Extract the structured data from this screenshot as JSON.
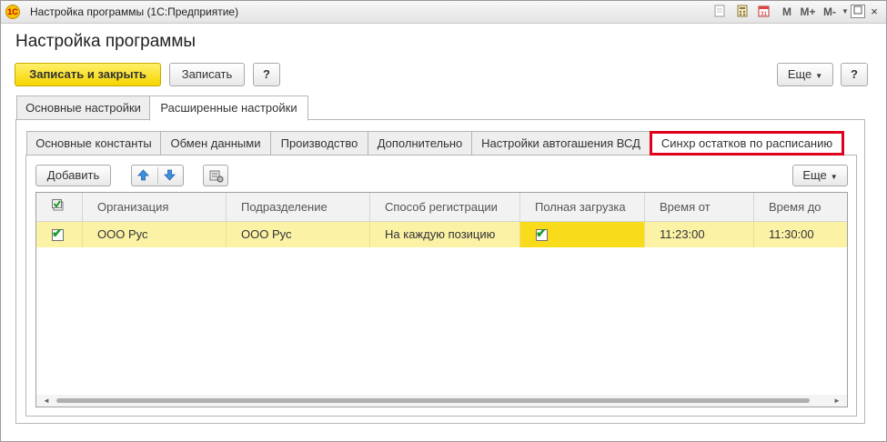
{
  "window": {
    "title": "Настройка программы  (1С:Предприятие)",
    "app_icon": "1c-logo-icon",
    "tool_m": "M",
    "tool_mplus": "M+",
    "tool_mminus": "M-",
    "close": "×"
  },
  "page": {
    "title": "Настройка программы"
  },
  "toolbar": {
    "save_close": "Записать и закрыть",
    "save": "Записать",
    "help": "?",
    "more": "Еще",
    "help2": "?"
  },
  "tabs": [
    {
      "label": "Основные настройки"
    },
    {
      "label": "Расширенные настройки"
    }
  ],
  "subtabs": [
    {
      "label": "Основные константы"
    },
    {
      "label": "Обмен данными"
    },
    {
      "label": "Производство"
    },
    {
      "label": "Дополнительно"
    },
    {
      "label": "Настройки автогашения ВСД"
    },
    {
      "label": "Синхр остатков по расписанию"
    }
  ],
  "table_toolbar": {
    "add": "Добавить",
    "more": "Еще"
  },
  "table": {
    "columns": [
      "Организация",
      "Подразделение",
      "Способ регистрации",
      "Полная загрузка",
      "Время от",
      "Время до"
    ],
    "rows": [
      {
        "active": true,
        "org": "ООО Рус",
        "dept": "ООО Рус",
        "method": "На каждую позицию",
        "full_load": true,
        "time_from": "11:23:00",
        "time_to": "11:30:00"
      }
    ]
  },
  "colors": {
    "highlight_border": "#e0001b",
    "primary_button": "#f6d500",
    "row_background": "#fbf2a6",
    "selected_cell": "#f8dc1c"
  }
}
